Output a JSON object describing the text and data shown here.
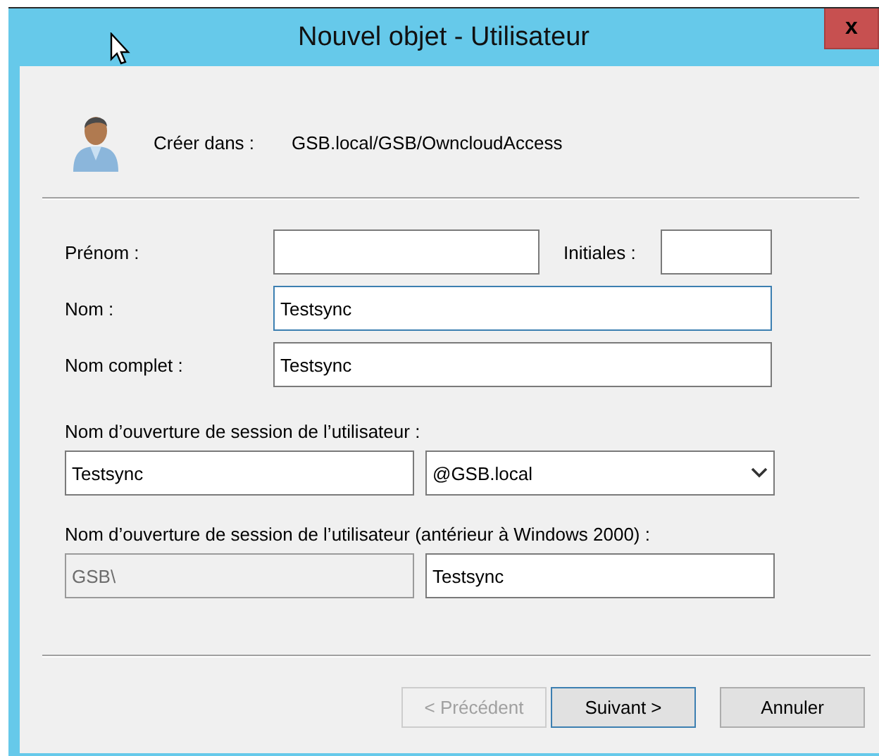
{
  "window": {
    "title": "Nouvel objet - Utilisateur",
    "close_button": "x"
  },
  "location": {
    "label": "Créer dans :",
    "path": "GSB.local/GSB/OwncloudAccess"
  },
  "first_name": {
    "label": "Prénom :"
  },
  "initials": {
    "label": "Initiales :"
  },
  "last_name": {
    "label": "Nom :",
    "value": "Testsync",
    "focused": true
  },
  "full_name": {
    "label": "Nom complet :",
    "value": "Testsync",
    "focused": false
  },
  "logon": {
    "label": "Nom d’ouverture de session de l’utilisateur :",
    "value": "Testsync",
    "domain": "@GSB.local"
  },
  "logon_pre2000": {
    "label": "Nom d’ouverture de session de l’utilisateur (antérieur à Windows 2000) :",
    "domain": {
      "value": "GSB\\",
      "disabled": true
    },
    "value": "Testsync"
  },
  "buttons": [
    {
      "label": "< Précédent",
      "disabled": true,
      "default": false
    },
    {
      "label": "Suivant >",
      "disabled": false,
      "default": true
    },
    {
      "label": "Annuler",
      "disabled": false,
      "default": false
    }
  ]
}
